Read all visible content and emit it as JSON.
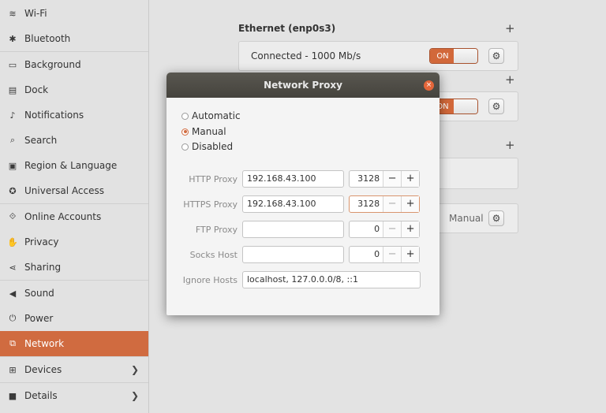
{
  "sidebar": {
    "items": [
      {
        "label": "Wi-Fi",
        "icon": "wifi-icon",
        "glyph": "≋"
      },
      {
        "label": "Bluetooth",
        "icon": "bluetooth-icon",
        "glyph": "✱"
      },
      {
        "label": "Background",
        "icon": "monitor-icon",
        "glyph": "▭"
      },
      {
        "label": "Dock",
        "icon": "dock-icon",
        "glyph": "▤"
      },
      {
        "label": "Notifications",
        "icon": "bell-icon",
        "glyph": "♪"
      },
      {
        "label": "Search",
        "icon": "search-icon",
        "glyph": "⌕"
      },
      {
        "label": "Region & Language",
        "icon": "camera-icon",
        "glyph": "▣"
      },
      {
        "label": "Universal Access",
        "icon": "accessibility-icon",
        "glyph": "✪"
      },
      {
        "label": "Online Accounts",
        "icon": "online-accounts-icon",
        "glyph": "⟐"
      },
      {
        "label": "Privacy",
        "icon": "hand-icon",
        "glyph": "✋"
      },
      {
        "label": "Sharing",
        "icon": "share-icon",
        "glyph": "⋖"
      },
      {
        "label": "Sound",
        "icon": "speaker-icon",
        "glyph": "◀"
      },
      {
        "label": "Power",
        "icon": "power-icon",
        "glyph": "⏻"
      },
      {
        "label": "Network",
        "icon": "network-icon",
        "glyph": "⧉"
      },
      {
        "label": "Devices",
        "icon": "devices-icon",
        "glyph": "⊞"
      },
      {
        "label": "Details",
        "icon": "details-icon",
        "glyph": "■"
      }
    ],
    "active": "Network"
  },
  "main": {
    "ethernet_title": "Ethernet (enp0s3)",
    "connected_text": "Connected - 1000 Mb/s",
    "toggle_on_label": "ON",
    "proxy_mode_label": "Manual",
    "plus_glyph": "+",
    "gear_glyph": "⚙"
  },
  "dialog": {
    "title": "Network Proxy",
    "close_glyph": "×",
    "modes": [
      {
        "label": "Automatic",
        "checked": false
      },
      {
        "label": "Manual",
        "checked": true
      },
      {
        "label": "Disabled",
        "checked": false
      }
    ],
    "fields": [
      {
        "label": "HTTP Proxy",
        "host": "192.168.43.100",
        "port": "3128"
      },
      {
        "label": "HTTPS Proxy",
        "host": "192.168.43.100",
        "port": "3128"
      },
      {
        "label": "FTP Proxy",
        "host": "",
        "port": "0"
      },
      {
        "label": "Socks Host",
        "host": "",
        "port": "0"
      }
    ],
    "ignore_hosts_label": "Ignore Hosts",
    "ignore_hosts_value": "localhost, 127.0.0.0/8, ::1",
    "minus_glyph": "−",
    "plus_glyph": "+"
  }
}
